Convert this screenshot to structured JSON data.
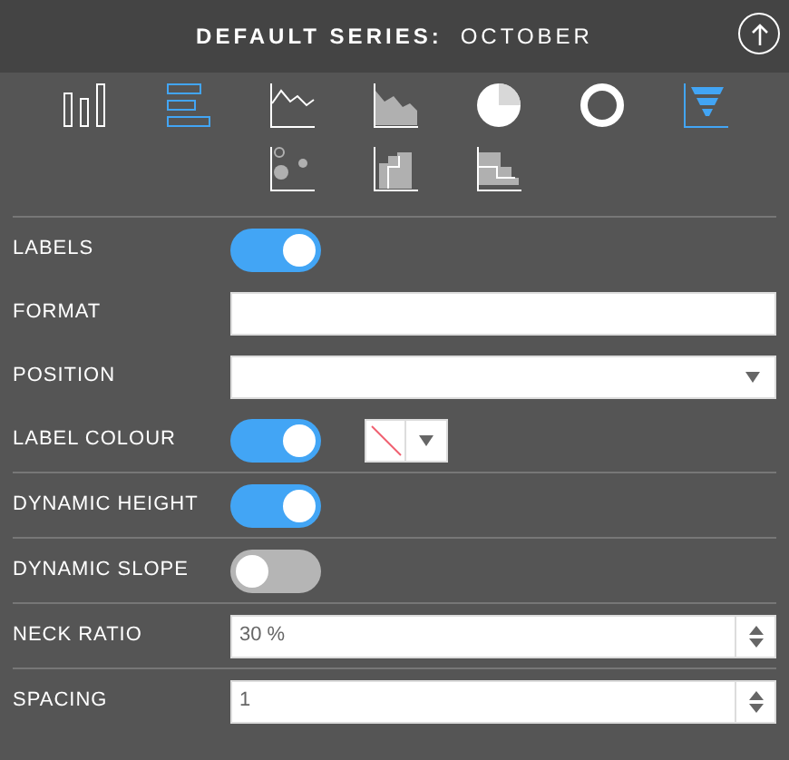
{
  "header": {
    "title": "DEFAULT SERIES:",
    "series": "OCTOBER"
  },
  "chart_types": [
    [
      {
        "kind": "column",
        "selected": false
      },
      {
        "kind": "bar",
        "selected": true
      },
      {
        "kind": "line",
        "selected": false
      },
      {
        "kind": "area",
        "selected": false
      },
      {
        "kind": "pie",
        "selected": false
      },
      {
        "kind": "donut",
        "selected": false
      },
      {
        "kind": "funnel",
        "selected": true
      }
    ],
    [
      {
        "kind": "bubble",
        "selected": false
      },
      {
        "kind": "step",
        "selected": false
      },
      {
        "kind": "stepbar",
        "selected": false
      }
    ]
  ],
  "groups": [
    [
      {
        "kind": "toggle",
        "label": "LABELS",
        "on": true
      },
      {
        "kind": "text",
        "label": "FORMAT"
      },
      {
        "kind": "select",
        "label": "POSITION"
      },
      {
        "kind": "toggle_colour",
        "label": "LABEL COLOUR",
        "on": true
      }
    ],
    [
      {
        "kind": "toggle",
        "label": "DYNAMIC HEIGHT",
        "on": true
      }
    ],
    [
      {
        "kind": "toggle",
        "label": "DYNAMIC SLOPE",
        "on": false
      }
    ],
    [
      {
        "kind": "number",
        "label": "NECK RATIO",
        "value": "30 %"
      }
    ],
    [
      {
        "kind": "number",
        "label": "SPACING",
        "value": "1"
      }
    ]
  ]
}
